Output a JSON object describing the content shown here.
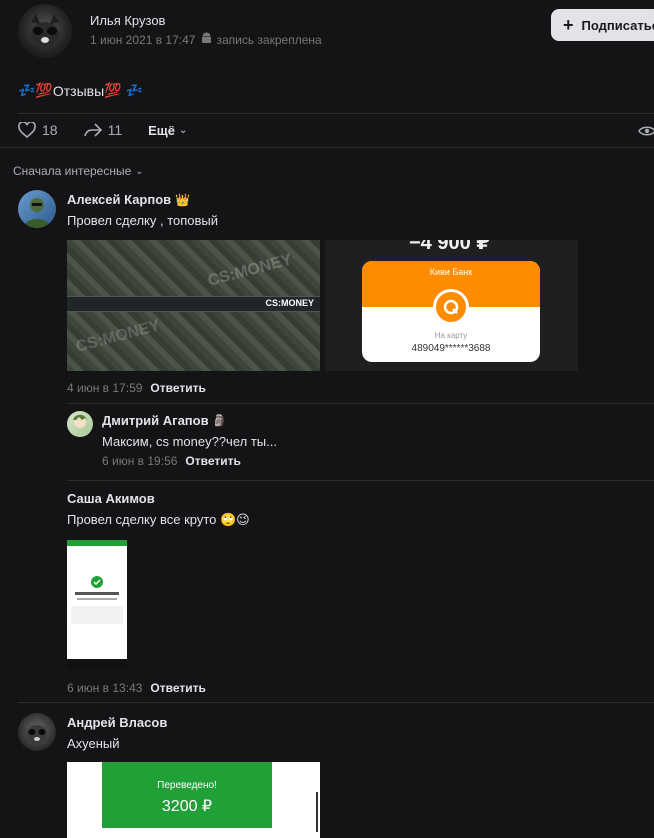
{
  "post": {
    "author": "Илья Крузов",
    "date": "1 июн 2021 в 17:47",
    "pinned_label": "запись закреплена",
    "subscribe_label": "Подписаться",
    "title_prefix": "💤💯",
    "title_text": "Отзывы",
    "title_suffix": "💯 💤",
    "likes": "18",
    "shares": "11",
    "more_label": "Ещё"
  },
  "comments_sort": "Сначала интересные",
  "comments": [
    {
      "author": "Алексей Карпов",
      "badge": "👑",
      "text": "Провел сделку , топовый",
      "date": "4 июн в 17:59",
      "reply": "Ответить",
      "qiwi_amount": "−4 900 ₽",
      "qiwi_bank": "Киви Банк",
      "qiwi_to_card": "На карту",
      "qiwi_card": "489049******3688",
      "banner_brand": "CS:MONEY"
    },
    {
      "author": "Дмитрий Агапов",
      "badge": "🗿",
      "text": "Максим, cs money??чел ты...",
      "date": "6 июн в 19:56",
      "reply": "Ответить"
    },
    {
      "author": "Саша Акимов",
      "text": "Провел сделку все круто 🙄😉",
      "date": "6 июн в 13:43",
      "reply": "Ответить"
    },
    {
      "author": "Андрей Власов",
      "text": "Ахуеный",
      "transfer_label": "Переведено!",
      "transfer_amount": "3200 ₽"
    }
  ],
  "colors": {
    "background": "#141416",
    "divider": "#2c2d2e",
    "qiwi_orange": "#ff8c00",
    "sber_green": "#21a038"
  }
}
